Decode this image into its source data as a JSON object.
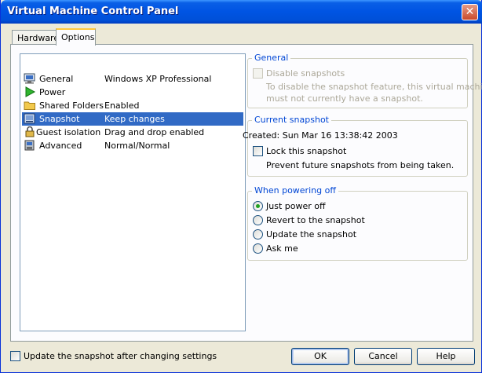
{
  "window": {
    "title": "Virtual Machine Control Panel",
    "close_glyph": "✕"
  },
  "tabs": [
    {
      "label": "Hardware",
      "active": false
    },
    {
      "label": "Options",
      "active": true
    }
  ],
  "options_list": [
    {
      "icon": "monitor-icon",
      "name": "General",
      "value": "Windows XP Professional"
    },
    {
      "icon": "play-icon",
      "name": "Power",
      "value": ""
    },
    {
      "icon": "folder-icon",
      "name": "Shared Folders",
      "value": "Enabled"
    },
    {
      "icon": "snapshot-icon",
      "name": "Snapshot",
      "value": "Keep changes",
      "selected": true
    },
    {
      "icon": "lock-icon",
      "name": "Guest isolation",
      "value": "Drag and drop enabled"
    },
    {
      "icon": "computer-icon",
      "name": "Advanced",
      "value": "Normal/Normal"
    }
  ],
  "general": {
    "legend": "General",
    "disable_label": "Disable snapshots",
    "note_line1": "To disable the snapshot feature, this virtual machine",
    "note_line2": "must not currently have a snapshot."
  },
  "current_snapshot": {
    "legend": "Current snapshot",
    "created": "Created:  Sun Mar 16 13:38:42 2003",
    "lock_label": "Lock this snapshot",
    "lock_note": "Prevent future snapshots from being taken."
  },
  "powering_off": {
    "legend": "When powering off",
    "options": [
      {
        "label": "Just power off",
        "checked": true
      },
      {
        "label": "Revert to the snapshot",
        "checked": false
      },
      {
        "label": "Update the snapshot",
        "checked": false
      },
      {
        "label": "Ask me",
        "checked": false
      }
    ]
  },
  "footer": {
    "update_checkbox": "Update the snapshot after changing settings",
    "ok": "OK",
    "cancel": "Cancel",
    "help": "Help"
  },
  "colors": {
    "titlebar": "#0054e3",
    "selection": "#316ac5",
    "legend": "#0046d5",
    "dialog_bg": "#ece9d8"
  }
}
